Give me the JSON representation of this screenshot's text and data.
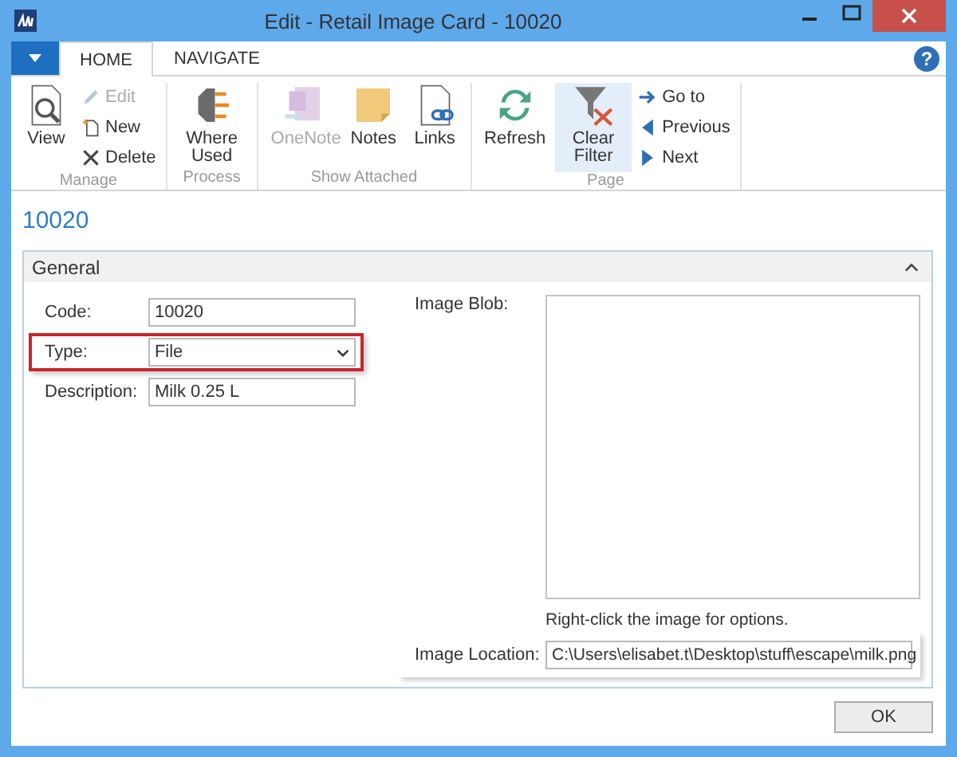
{
  "window": {
    "title": "Edit - Retail Image Card - 10020"
  },
  "tabs": [
    {
      "label": "HOME",
      "selected": true
    },
    {
      "label": "NAVIGATE",
      "selected": false
    }
  ],
  "help": "?",
  "ribbon": [
    {
      "label": "Manage",
      "items": [
        {
          "label": "View",
          "kind": "large",
          "disabled": false
        },
        {
          "label": "Edit",
          "kind": "small",
          "disabled": true
        },
        {
          "label": "New",
          "kind": "small",
          "disabled": false
        },
        {
          "label": "Delete",
          "kind": "small",
          "disabled": false
        }
      ]
    },
    {
      "label": "Process",
      "items": [
        {
          "label": "Where Used",
          "kind": "large",
          "disabled": false
        }
      ]
    },
    {
      "label": "Show Attached",
      "items": [
        {
          "label": "OneNote",
          "kind": "large",
          "disabled": true
        },
        {
          "label": "Notes",
          "kind": "large",
          "disabled": false
        },
        {
          "label": "Links",
          "kind": "large",
          "disabled": false
        }
      ]
    },
    {
      "label": "Page",
      "items": [
        {
          "label": "Refresh",
          "kind": "large",
          "disabled": false
        },
        {
          "label": "Clear Filter",
          "kind": "large",
          "disabled": false,
          "highlighted": true
        },
        {
          "label": "Go to",
          "kind": "small",
          "disabled": false
        },
        {
          "label": "Previous",
          "kind": "small",
          "disabled": false
        },
        {
          "label": "Next",
          "kind": "small",
          "disabled": false
        }
      ]
    }
  ],
  "heading": "10020",
  "panel": {
    "title": "General",
    "expanded": true
  },
  "fields": [
    {
      "label": "Code:",
      "value": "10020",
      "kind": "text",
      "highlighted": false
    },
    {
      "label": "Type:",
      "value": "File",
      "kind": "dropdown",
      "highlighted": true
    },
    {
      "label": "Description:",
      "value": "Milk 0.25 L",
      "kind": "text",
      "highlighted": false
    }
  ],
  "image_blob": {
    "label": "Image Blob:",
    "hint": "Right-click the image for options."
  },
  "image_location": {
    "label": "Image Location:",
    "value": "C:\\Users\\elisabet.t\\Desktop\\stuff\\escape\\milk.png",
    "highlighted": true
  },
  "buttons": [
    "OK"
  ]
}
